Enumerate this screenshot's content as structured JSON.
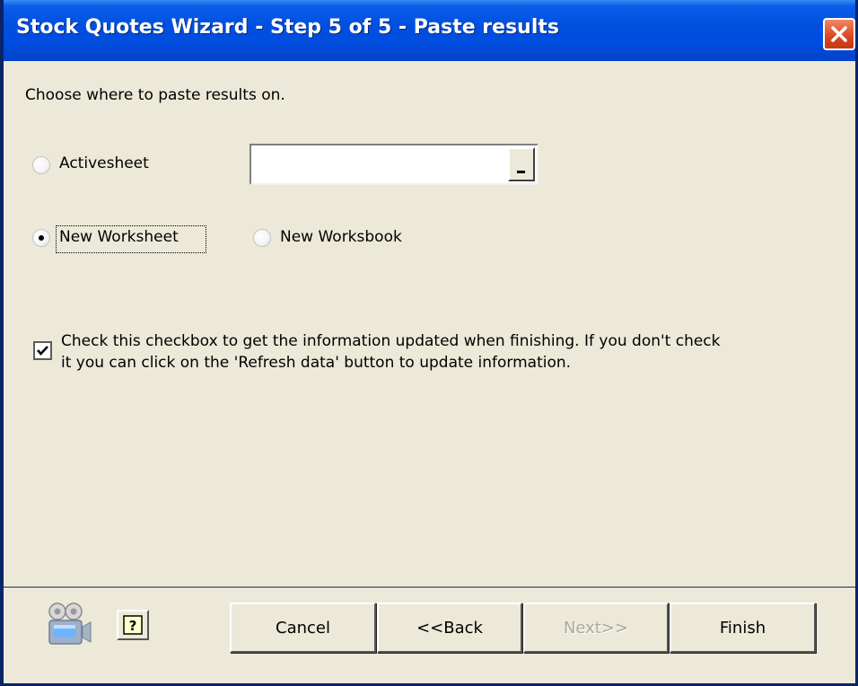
{
  "window": {
    "title": "Stock Quotes Wizard - Step 5 of 5 - Paste results"
  },
  "content": {
    "instruction": "Choose where to paste results on.",
    "activesheet_label": "Activesheet",
    "range_value": "",
    "new_worksheet_label": "New Worksheet",
    "new_workbook_label": "New Worksbook",
    "selected_option": "New Worksheet",
    "update_checkbox": {
      "checked": true,
      "line1": "Check this checkbox to get the information updated when finishing. If you don't check",
      "line2": "it you can click on the 'Refresh data' button to update information."
    }
  },
  "footer": {
    "cancel_label": "Cancel",
    "back_label": "<<Back",
    "next_label": "Next>>",
    "finish_label": "Finish",
    "help_icon": "help-question-icon",
    "camera_icon": "camera-icon"
  },
  "colors": {
    "titlebar": "#0050e0",
    "dialog_bg": "#ece9d8",
    "close_button": "#d9441c",
    "disabled_text": "#aca899"
  }
}
